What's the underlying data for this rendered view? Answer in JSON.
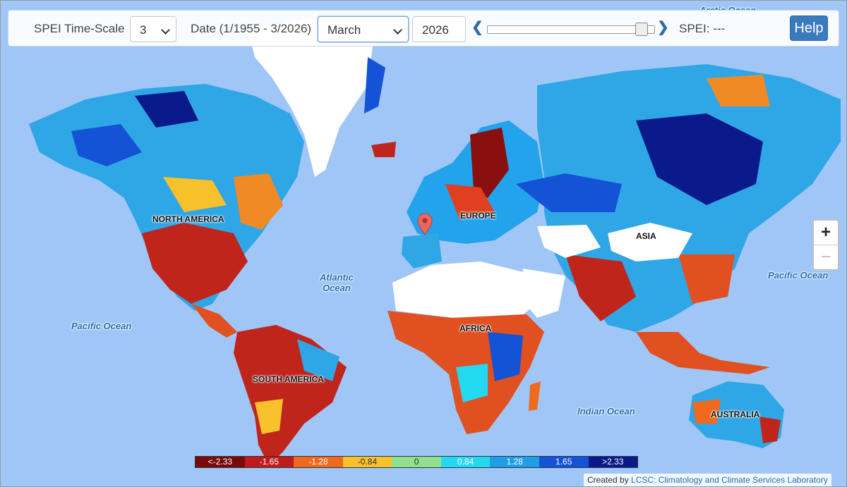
{
  "controls": {
    "timescale_label": "SPEI Time-Scale",
    "timescale_value": "3",
    "date_label": "Date (1/1955 - 3/2026)",
    "month_value": "March",
    "year_value": "2026",
    "spei_readout": "SPEI: ---",
    "help_label": "Help",
    "slider_position": 0.96
  },
  "zoom": {
    "in_label": "+",
    "out_label": "−"
  },
  "labels": {
    "oceans": {
      "arctic": "Arctic Ocean",
      "atlantic_line1": "Atlantic",
      "atlantic_line2": "Ocean",
      "pacific_west": "Pacific Ocean",
      "pacific_east": "Pacific Ocean",
      "indian": "Indian Ocean"
    },
    "continents": {
      "north_america": "NORTH AMERICA",
      "south_america": "SOUTH AMERICA",
      "europe": "EUROPE",
      "africa": "AFRICA",
      "asia": "ASIA",
      "australia": "AUSTRALIA"
    }
  },
  "legend": [
    {
      "label": "<-2.33",
      "color": "#7a0a0a"
    },
    {
      "label": "-1.65",
      "color": "#c01a1a"
    },
    {
      "label": "-1.28",
      "color": "#f06a1d"
    },
    {
      "label": "-0.84",
      "color": "#f6c12b"
    },
    {
      "label": "0",
      "color": "#8fe08f"
    },
    {
      "label": "0.84",
      "color": "#23d9f2"
    },
    {
      "label": "1.28",
      "color": "#1f9ee8"
    },
    {
      "label": "1.65",
      "color": "#1452d6"
    },
    {
      "label": ">2.33",
      "color": "#0a1a8a"
    }
  ],
  "credit": {
    "prefix": "Created by ",
    "link": "LCSC: Climatology and Climate Services Laboratory"
  },
  "colors": {
    "ocean": "#9fc6f7",
    "no_data": "#ffffff",
    "accent": "#3a7abf",
    "marker": "#e8675f"
  }
}
